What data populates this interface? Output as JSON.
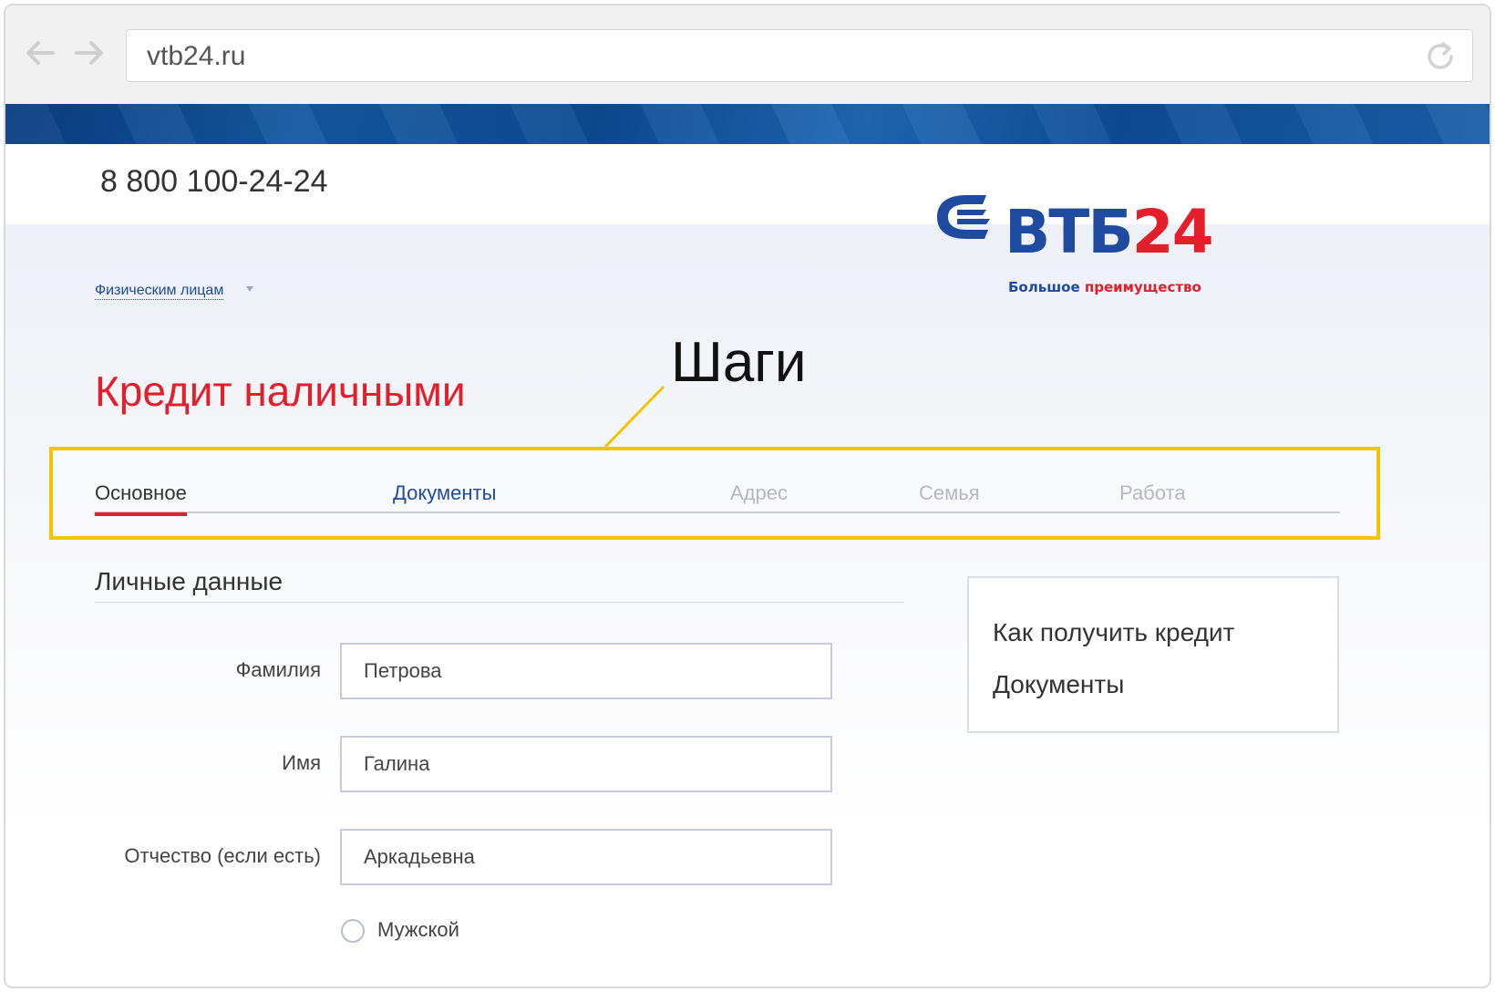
{
  "browser": {
    "url": "vtb24.ru"
  },
  "header": {
    "phone": "8 800 100-24-24",
    "segment_link": "Физическим лицам"
  },
  "logo": {
    "word_part1": "ВТБ",
    "word_part2": "24",
    "slogan_part1": "Большое",
    "slogan_part2": "преимущество"
  },
  "page": {
    "title": "Кредит наличными"
  },
  "annotation": {
    "label": "Шаги"
  },
  "steps": [
    {
      "label": "Основное",
      "state": "active"
    },
    {
      "label": "Документы",
      "state": "link"
    },
    {
      "label": "Адрес",
      "state": "disabled"
    },
    {
      "label": "Семья",
      "state": "disabled"
    },
    {
      "label": "Работа",
      "state": "disabled"
    }
  ],
  "form": {
    "section_title": "Личные данные",
    "fields": [
      {
        "label": "Фамилия",
        "value": "Петрова"
      },
      {
        "label": "Имя",
        "value": "Галина"
      },
      {
        "label": "Отчество (если есть)",
        "value": "Аркадьевна"
      }
    ],
    "gender_option": "Мужской"
  },
  "sidebar": {
    "links": [
      "Как получить кредит",
      "Документы"
    ]
  },
  "colors": {
    "brand_blue": "#1e4ba0",
    "brand_red": "#e41e2b",
    "highlight_yellow": "#f5c400"
  }
}
